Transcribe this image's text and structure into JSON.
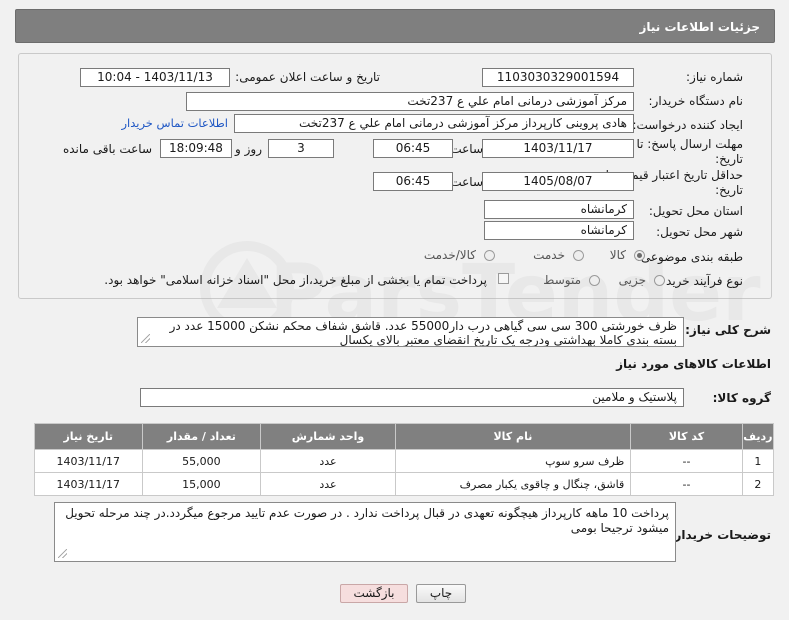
{
  "header": {
    "title": "جزئیات اطلاعات نیاز"
  },
  "form": {
    "need_number_label": "شماره نیاز:",
    "need_number": "1103030329001594",
    "announce_label": "تاریخ و ساعت اعلان عمومی:",
    "announce_value": "1403/11/13 - 10:04",
    "buyer_org_label": "نام دستگاه خریدار:",
    "buyer_org": "مرکز آموزشی درمانی امام علي ع 237تخت",
    "creator_label": "ایجاد کننده درخواست:",
    "creator": "هادی پروینی کارپرداز  مرکز آموزشی درمانی امام علي ع 237تخت",
    "contact_link": "اطلاعات تماس خریدار",
    "deadline_label_1": "مهلت ارسال پاسخ: تا",
    "deadline_label_2": "تاریخ:",
    "deadline_date": "1403/11/17",
    "time_label": "ساعت",
    "deadline_time": "06:45",
    "days_value": "3",
    "days_label": "روز و",
    "remaining_time": "18:09:48",
    "remaining_label": "ساعت باقی مانده",
    "min_validity_label_1": "حداقل تاریخ اعتبار قیمت: تا",
    "min_validity_label_2": "تاریخ:",
    "validity_date": "1405/08/07",
    "validity_time_label": "ساعت",
    "validity_time": "06:45",
    "province_label": "استان محل تحویل:",
    "province": "کرمانشاه",
    "city_label": "شهر محل تحویل:",
    "city": "کرمانشاه",
    "category_label": "طبقه بندی موضوعی:",
    "category_options": [
      "کالا",
      "خدمت",
      "کالا/خدمت"
    ],
    "process_label": "نوع فرآیند خرید :",
    "process_options": [
      "جزیی",
      "متوسط"
    ],
    "payment_note": "پرداخت تمام یا بخشی از مبلغ خرید،از محل \"اسناد خزانه اسلامی\" خواهد بود."
  },
  "description": {
    "label": "شرح کلی نیاز:",
    "text": "ظرف خورشتی 300 سی سی گیاهی درب دار55000 عدد.  قاشق شفاف محکم نشکن  15000 عدد در بسته بندی  کاملا بهداشتی  ودرجه یک تاریخ انقضای معتبر بالای یکسال"
  },
  "goods": {
    "section_title": "اطلاعات کالاهای مورد نیاز",
    "group_label": "گروه کالا:",
    "group_value": "پلاستیک و ملامین",
    "columns": [
      "ردیف",
      "کد کالا",
      "نام کالا",
      "واحد شمارش",
      "تعداد / مقدار",
      "تاریخ نیاز"
    ],
    "rows": [
      [
        "1",
        "--",
        "ظرف سرو سوپ",
        "عدد",
        "55,000",
        "1403/11/17"
      ],
      [
        "2",
        "--",
        "قاشق، چنگال و چاقوی یکبار مصرف",
        "عدد",
        "15,000",
        "1403/11/17"
      ]
    ]
  },
  "notes": {
    "label": "توضیحات خریدار:",
    "text": "پرداخت 10 ماهه کارپرداز هیچگونه تعهدی در قبال پرداخت ندارد . در صورت عدم تایید مرجوع میگردد.در چند مرحله تحویل میشود ترجیحا بومی"
  },
  "buttons": {
    "print": "چاپ",
    "back": "بازگشت"
  },
  "colors": {
    "header_bg": "#7f7f7f",
    "table_header_bg": "#808080",
    "link": "#1f57c4",
    "back_button_bg": "#f6dede"
  }
}
